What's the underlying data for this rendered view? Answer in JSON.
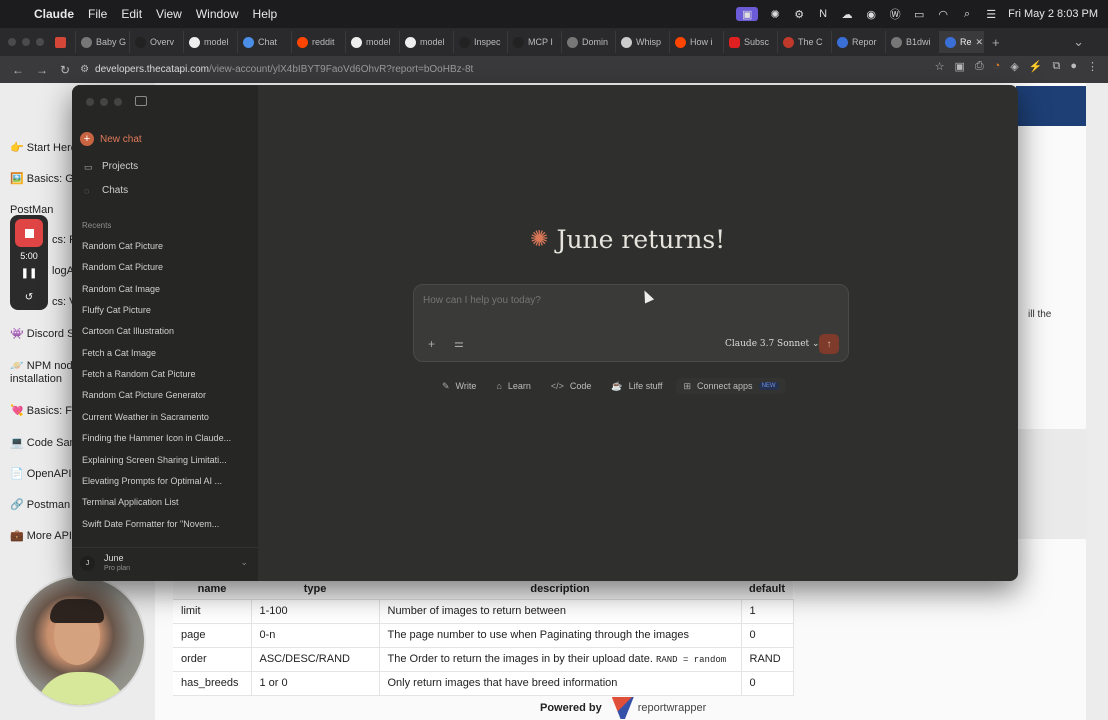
{
  "menubar": {
    "app": "Claude",
    "items": [
      "File",
      "Edit",
      "View",
      "Window",
      "Help"
    ],
    "clock": "Fri May 2  8:03 PM"
  },
  "tabs": [
    "",
    "Baby G",
    "Overv",
    "model",
    "Chat",
    "reddit",
    "model",
    "model",
    "Inspec",
    "MCP I",
    "Domin",
    "Whisp",
    "How i",
    "Subsc",
    "The C",
    "Repor",
    "B1dwi",
    "Re"
  ],
  "address": {
    "host": "developers.thecatapi.com",
    "path": "/view-account/ylX4bIBYT9FaoVd6OhvR?report=bOoHBz-8t"
  },
  "background_page": {
    "links": [
      "👉 Start Here",
      "🖼️ Basics: Ge",
      "PostMan",
      "cs: Fil",
      "logAF",
      "cs: Vo",
      "👾 Discord Se",
      "🪐 NPM node",
      "installation",
      "💘 Basics: Fa",
      "💻 Code Sam",
      "📄 OpenAPI S",
      "🔗 Postman A",
      "💼 More APIs"
    ],
    "side_text": "ill the",
    "table": {
      "headers": [
        "name",
        "type",
        "description",
        "default"
      ],
      "rows": [
        {
          "name": "limit",
          "type": "1-100",
          "description": "Number of images to return between",
          "default": "1"
        },
        {
          "name": "page",
          "type": "0-n",
          "description": "The page number to use when Paginating through the images",
          "default": "0"
        },
        {
          "name": "order",
          "type": "ASC/DESC/RAND",
          "description": "The Order to return the images in by their upload date.",
          "code": "RAND = random",
          "default": "RAND"
        },
        {
          "name": "has_breeds",
          "type": "1 or 0",
          "description": "Only return images that have breed information",
          "default": "0"
        }
      ]
    },
    "powered_by": "Powered by",
    "powered_brand": "reportwrapper"
  },
  "recorder": {
    "time": "5:00"
  },
  "claude": {
    "new_chat": "New chat",
    "projects": "Projects",
    "chats": "Chats",
    "recents_label": "Recents",
    "recents": [
      "Random Cat Picture",
      "Random Cat Picture",
      "Random Cat Image",
      "Fluffy Cat Picture",
      "Cartoon Cat Illustration",
      "Fetch a Cat Image",
      "Fetch a Random Cat Picture",
      "Random Cat Picture Generator",
      "Current Weather in Sacramento",
      "Finding the Hammer Icon in Claude...",
      "Explaining Screen Sharing Limitati...",
      "Elevating Prompts for Optimal AI ...",
      "Terminal Application List",
      "Swift Date Formatter for \"Novem..."
    ],
    "user": {
      "initial": "J",
      "name": "June",
      "plan": "Pro plan"
    },
    "greeting": "June returns!",
    "input_placeholder": "How can I help you today?",
    "model": "Claude 3.7 Sonnet",
    "chips": [
      {
        "icon": "pencil-icon",
        "label": "Write"
      },
      {
        "icon": "graduation-cap-icon",
        "label": "Learn"
      },
      {
        "icon": "code-icon",
        "label": "Code"
      },
      {
        "icon": "coffee-icon",
        "label": "Life stuff"
      },
      {
        "icon": "grid-icon",
        "label": "Connect apps",
        "badge": "NEW"
      }
    ]
  }
}
